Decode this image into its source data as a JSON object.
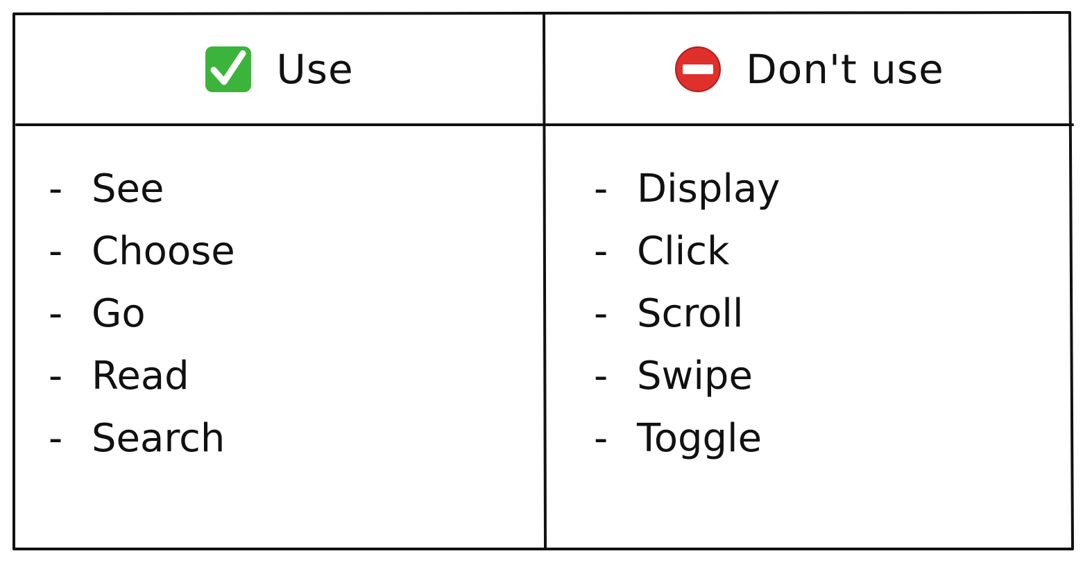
{
  "columns": [
    {
      "header": "Use",
      "header_icon": "check-mark-button-icon",
      "items": [
        "See",
        "Choose",
        "Go",
        "Read",
        "Search"
      ]
    },
    {
      "header": "Don't use",
      "header_icon": "no-entry-icon",
      "items": [
        "Display",
        "Click",
        "Scroll",
        "Swipe",
        "Toggle"
      ]
    }
  ],
  "bullet": "-",
  "colors": {
    "ink": "#111111",
    "check_green": "#3cb43c",
    "no_entry_red": "#e0302c"
  }
}
